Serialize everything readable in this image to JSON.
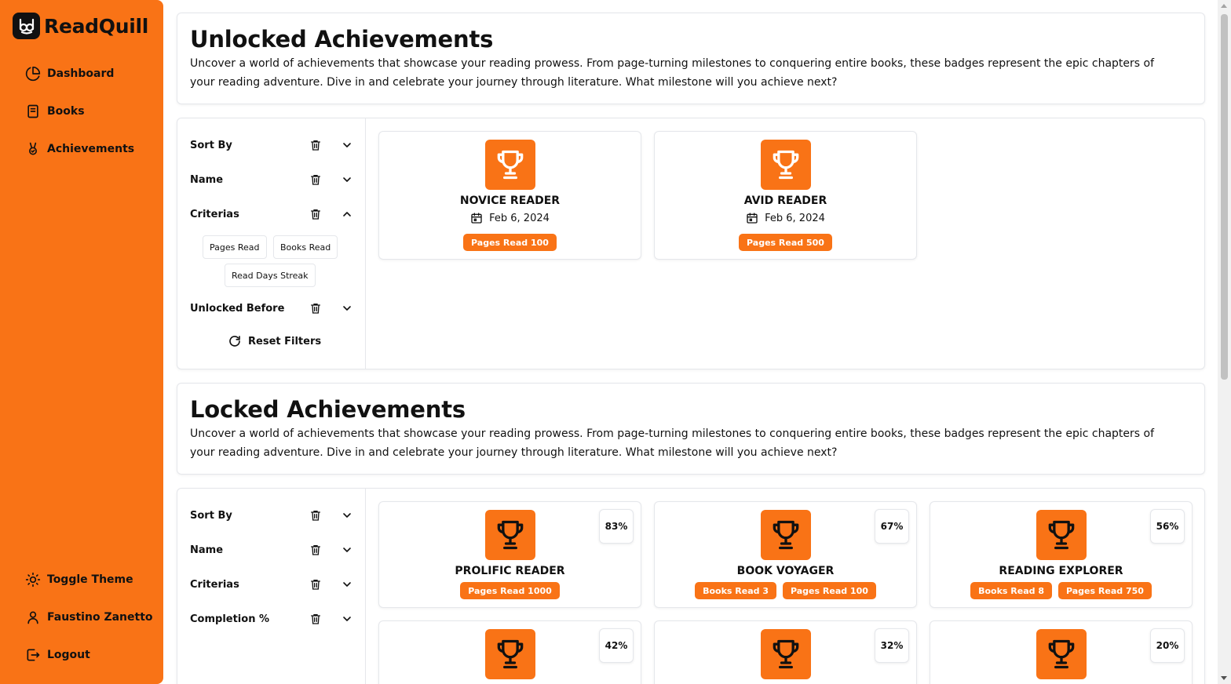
{
  "app": {
    "name": "ReadQuill"
  },
  "sidebar": {
    "items": [
      {
        "label": "Dashboard",
        "icon": "pie-chart-icon"
      },
      {
        "label": "Books",
        "icon": "book-icon"
      },
      {
        "label": "Achievements",
        "icon": "award-icon"
      }
    ],
    "bottom": [
      {
        "label": "Toggle Theme",
        "icon": "sun-icon"
      },
      {
        "label": "Faustino Zanetto",
        "icon": "user-icon"
      },
      {
        "label": "Logout",
        "icon": "logout-icon"
      }
    ]
  },
  "unlocked": {
    "title": "Unlocked Achievements",
    "description": "Uncover a world of achievements that showcase your reading prowess. From page-turning milestones to conquering entire books, these badges represent the epic chapters of your reading adventure. Dive in and celebrate your journey through literature. What milestone will you achieve next?",
    "filters": [
      {
        "label": "Sort By",
        "expanded": false
      },
      {
        "label": "Name",
        "expanded": false
      },
      {
        "label": "Criterias",
        "expanded": true
      },
      {
        "label": "Unlocked Before",
        "expanded": false
      }
    ],
    "criteria_chips": [
      "Pages Read",
      "Books Read",
      "Read Days Streak"
    ],
    "reset_label": "Reset Filters",
    "achievements": [
      {
        "name": "NOVICE READER",
        "date": "Feb 6, 2024",
        "badges": [
          "Pages Read 100"
        ]
      },
      {
        "name": "AVID READER",
        "date": "Feb 6, 2024",
        "badges": [
          "Pages Read 500"
        ]
      }
    ]
  },
  "locked": {
    "title": "Locked Achievements",
    "description": "Uncover a world of achievements that showcase your reading prowess. From page-turning milestones to conquering entire books, these badges represent the epic chapters of your reading adventure. Dive in and celebrate your journey through literature. What milestone will you achieve next?",
    "filters": [
      {
        "label": "Sort By"
      },
      {
        "label": "Name"
      },
      {
        "label": "Criterias"
      },
      {
        "label": "Completion %"
      }
    ],
    "achievements": [
      {
        "name": "PROLIFIC READER",
        "completion": "83%",
        "badges": [
          "Pages Read 1000"
        ]
      },
      {
        "name": "BOOK VOYAGER",
        "completion": "67%",
        "badges": [
          "Books Read 3",
          "Pages Read 100"
        ]
      },
      {
        "name": "READING EXPLORER",
        "completion": "56%",
        "badges": [
          "Books Read 8",
          "Pages Read 750"
        ]
      },
      {
        "name": "",
        "completion": "42%",
        "badges": []
      },
      {
        "name": "",
        "completion": "32%",
        "badges": []
      },
      {
        "name": "",
        "completion": "20%",
        "badges": []
      }
    ]
  },
  "colors": {
    "accent": "#f97316",
    "text": "#111111",
    "border": "#e5e7eb"
  }
}
